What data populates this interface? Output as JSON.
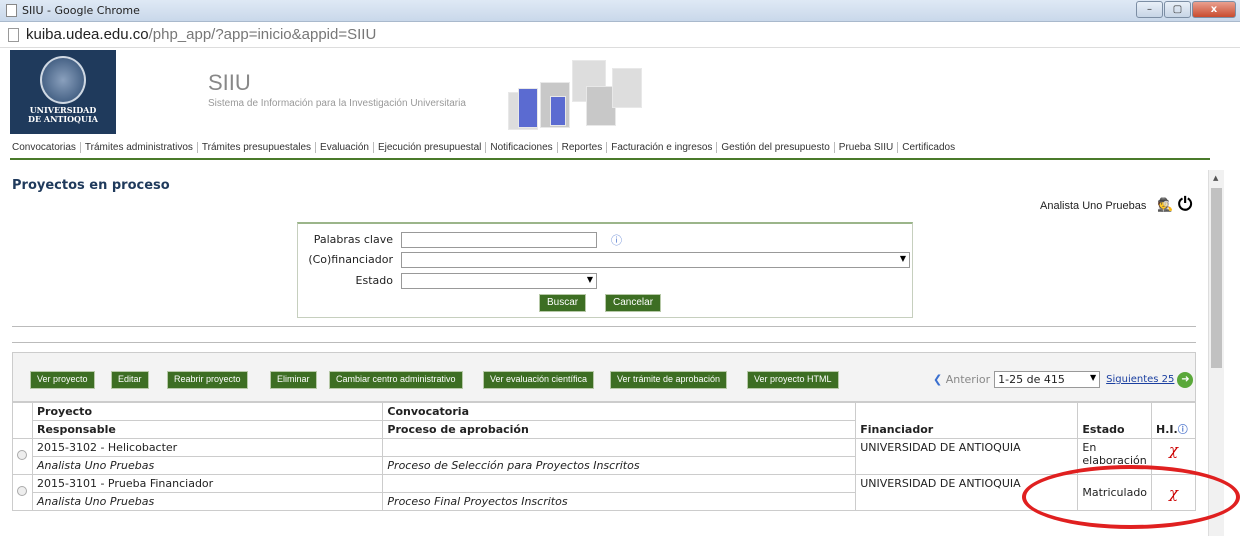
{
  "window": {
    "title": "SIIU - Google Chrome",
    "buttons": [
      "–",
      "▢",
      "x"
    ]
  },
  "address": {
    "host": "kuiba.udea.edu.co",
    "path": "/php_app/?app=inicio&appid=SIIU"
  },
  "brand": {
    "logo_line1": "UNIVERSIDAD",
    "logo_line2": "DE ANTIOQUIA",
    "title": "SIIU",
    "subtitle": "Sistema de Información para la Investigación Universitaria"
  },
  "menu": [
    "Convocatorias",
    "Trámites administrativos",
    "Trámites presupuestales",
    "Evaluación",
    "Ejecución presupuestal",
    "Notificaciones",
    "Reportes",
    "Facturación e ingresos",
    "Gestión del presupuesto",
    "Prueba SIIU",
    "Certificados"
  ],
  "page": {
    "title": "Proyectos en proceso",
    "user": "Analista Uno Pruebas"
  },
  "search": {
    "keywords_label": "Palabras clave",
    "cofin_label": "(Co)financiador",
    "estado_label": "Estado",
    "search_button": "Buscar",
    "cancel_button": "Cancelar"
  },
  "toolbar": {
    "buttons": [
      "Ver proyecto",
      "Editar",
      "Reabrir proyecto",
      "Eliminar",
      "Cambiar centro administrativo",
      "Ver evaluación científica",
      "Ver trámite de aprobación",
      "Ver proyecto HTML"
    ],
    "prev": "Anterior",
    "range": "1-25 de 415",
    "next": "Siguientes 25"
  },
  "table": {
    "headers": {
      "proyecto": "Proyecto",
      "responsable": "Responsable",
      "convocatoria": "Convocatoria",
      "proceso": "Proceso de aprobación",
      "financiador": "Financiador",
      "estado": "Estado",
      "hi": "H.I."
    },
    "rows": [
      {
        "proyecto": "2015-3102 - Helicobacter",
        "responsable": "Analista Uno Pruebas",
        "convocatoria": "",
        "proceso": "Proceso de Selección para Proyectos Inscritos",
        "financiador": "UNIVERSIDAD DE ANTIOQUIA",
        "estado": "En elaboración"
      },
      {
        "proyecto": "2015-3101 - Prueba Financiador",
        "responsable": "Analista Uno Pruebas",
        "convocatoria": "",
        "proceso": "Proceso Final Proyectos Inscritos",
        "financiador": "UNIVERSIDAD DE ANTIOQUIA",
        "estado": "Matriculado"
      }
    ]
  }
}
